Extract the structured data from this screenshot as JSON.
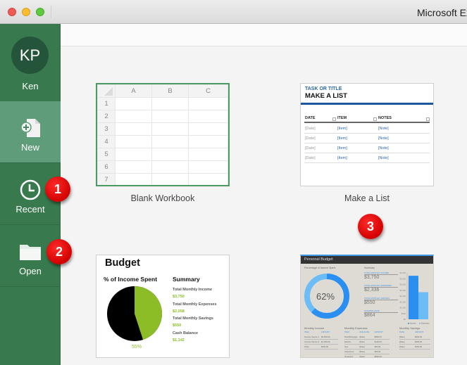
{
  "window": {
    "title": "Microsoft Excel",
    "controls": [
      "close",
      "minimize",
      "zoom"
    ]
  },
  "sidebar": {
    "profile": {
      "initials": "KP",
      "name": "Ken"
    },
    "items": [
      {
        "label": "New",
        "icon": "new-document-icon",
        "active": true
      },
      {
        "label": "Recent",
        "icon": "clock-icon",
        "active": false
      },
      {
        "label": "Open",
        "icon": "folder-icon",
        "active": false
      }
    ]
  },
  "templates": [
    {
      "name": "Blank Workbook",
      "selected": true,
      "columns": [
        "A",
        "B",
        "C"
      ],
      "rows": [
        "1",
        "2",
        "3",
        "4",
        "5",
        "6",
        "7"
      ]
    },
    {
      "name": "Make a List",
      "subtitle": "TASK OR TITLE",
      "title": "MAKE A LIST",
      "headers": [
        "DATE",
        "ITEM",
        "NOTES"
      ],
      "rows": [
        [
          "[Date]",
          "[Item]",
          "[Note]"
        ],
        [
          "[Date]",
          "[Item]",
          "[Note]"
        ],
        [
          "[Date]",
          "[Item]",
          "[Note]"
        ],
        [
          "[Date]",
          "[Item]",
          "[Note]"
        ]
      ]
    },
    {
      "name": "Budget",
      "title": "Budget",
      "chart_title": "% of Income Spent",
      "percent_label": "55%",
      "percent_spent": 55,
      "summary_title": "Summary",
      "summary": [
        {
          "label": "Total Monthly Income",
          "value": "$3,750"
        },
        {
          "label": "Total Monthly Expenses",
          "value": "$2,058"
        },
        {
          "label": "Total Monthly Savings",
          "value": "$550"
        },
        {
          "label": "Cash Balance",
          "value": "$1,142"
        }
      ],
      "colors": {
        "spent": "#000000",
        "remaining": "#8cbd27"
      }
    },
    {
      "name": "Personal Budget",
      "title": "Personal Budget",
      "chart_title": "Percentage of Income Spent",
      "percent_label": "62%",
      "percent_spent": 62,
      "summary_title": "Summary",
      "summary": [
        {
          "label": "TOTAL MONTHLY INCOME",
          "value": "$3,750"
        },
        {
          "label": "TOTAL MONTHLY EXPENSES",
          "value": "$2,336"
        },
        {
          "label": "TOTAL MONTHLY SAVINGS",
          "value": "$550"
        },
        {
          "label": "CASH BALANCE",
          "value": "$864"
        }
      ],
      "bar_chart": {
        "y_ticks": [
          "$4,000",
          "$3,500",
          "$3,000",
          "$2,500",
          "$2,000",
          "$1,500",
          "$1,000",
          "$500",
          "$0"
        ],
        "ylim": [
          0,
          4000
        ],
        "series": [
          {
            "name": "Income",
            "value": 3750,
            "color": "#2a8ff0"
          },
          {
            "name": "Expenses",
            "value": 2336,
            "color": "#6bbcf7"
          }
        ]
      },
      "tables": [
        {
          "title": "Monthly Income",
          "headers": [
            "ITEM",
            "AMOUNT"
          ],
          "rows": [
            [
              "Income Source 1",
              "$2,500.00"
            ],
            [
              "Income Source 2",
              "$1,000.00"
            ],
            [
              "Other",
              "$250.00"
            ]
          ]
        },
        {
          "title": "Monthly Expenses",
          "headers": [
            "ITEM",
            "DUE DATE",
            "AMOUNT"
          ],
          "rows": [
            [
              "Rent/Mortgage",
              "[Date]",
              "$800.00"
            ],
            [
              "Electric",
              "[Date]",
              "$120.00"
            ],
            [
              "Gas",
              "[Date]",
              "$50.00"
            ],
            [
              "Cell phone",
              "[Date]",
              "$45.00"
            ],
            [
              "Groceries",
              "[Date]",
              "$500.00"
            ]
          ]
        },
        {
          "title": "Monthly Savings",
          "headers": [
            "DATE",
            "AMOUNT"
          ],
          "rows": [
            [
              "[Date]",
              "$200.00"
            ],
            [
              "[Date]",
              "$200.00"
            ],
            [
              "[Date]",
              "$150.00"
            ]
          ]
        }
      ]
    }
  ],
  "callouts": [
    "1",
    "2",
    "3"
  ]
}
